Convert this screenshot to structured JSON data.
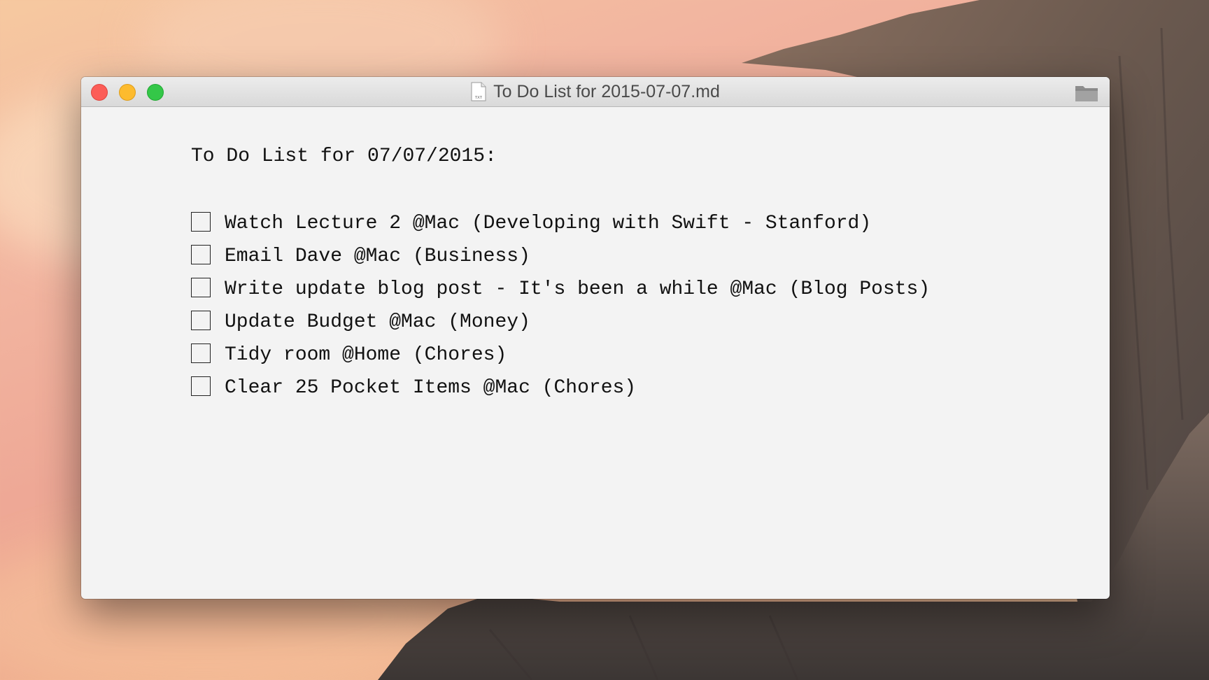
{
  "window": {
    "title": "To Do List for 2015-07-07.md",
    "doc_icon_label": "TXT"
  },
  "document": {
    "heading": "To Do List for 07/07/2015:",
    "items": [
      {
        "checked": false,
        "text": "Watch Lecture 2 @Mac (Developing with Swift - Stanford)"
      },
      {
        "checked": false,
        "text": "Email Dave @Mac (Business)"
      },
      {
        "checked": false,
        "text": "Write update blog post - It's been a while @Mac (Blog Posts)"
      },
      {
        "checked": false,
        "text": "Update Budget @Mac (Money)"
      },
      {
        "checked": false,
        "text": "Tidy room @Home (Chores)"
      },
      {
        "checked": false,
        "text": "Clear 25 Pocket Items @Mac (Chores)"
      }
    ]
  },
  "colors": {
    "close": "#fc5d57",
    "minimize": "#fdbb2e",
    "maximize": "#34c748",
    "window_bg": "#f3f3f3"
  }
}
